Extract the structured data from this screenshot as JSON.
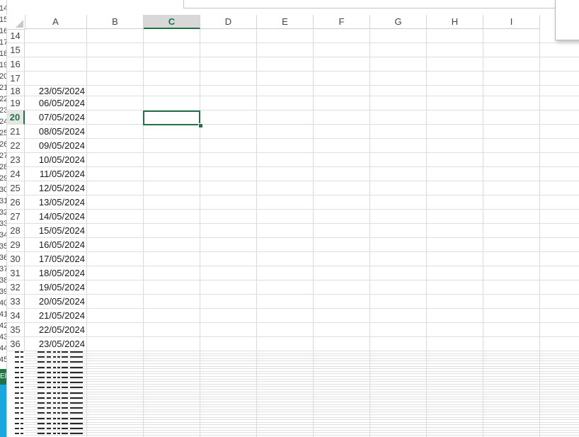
{
  "background_window": {
    "row_numbers": [
      "14",
      "15",
      "16",
      "17",
      "18",
      "19",
      "20",
      "21",
      "22",
      "23",
      "24",
      "25",
      "26",
      "27",
      "28",
      "29",
      "30",
      "31",
      "32",
      "33",
      "34",
      "35",
      "36",
      "37",
      "38",
      "39",
      "40",
      "41",
      "42",
      "43",
      "44",
      "45"
    ],
    "ribbon_text": "El",
    "colors": {
      "green_tab": "#217346",
      "blue_panel": "#1aa7e0"
    }
  },
  "sheet": {
    "columns": [
      "A",
      "B",
      "C",
      "D",
      "E",
      "F",
      "G",
      "H",
      "I"
    ],
    "selected_column": "C",
    "selected_row": "20",
    "active_cell": "C20",
    "rows": [
      {
        "num": "14",
        "a": ""
      },
      {
        "num": "15",
        "a": ""
      },
      {
        "num": "16",
        "a": ""
      },
      {
        "num": "17",
        "a": ""
      },
      {
        "num": "18",
        "a": "23/05/2024"
      },
      {
        "num": "19",
        "a": "06/05/2024"
      },
      {
        "num": "20",
        "a": "07/05/2024"
      },
      {
        "num": "21",
        "a": "08/05/2024"
      },
      {
        "num": "22",
        "a": "09/05/2024"
      },
      {
        "num": "23",
        "a": "10/05/2024"
      },
      {
        "num": "24",
        "a": "11/05/2024"
      },
      {
        "num": "25",
        "a": "12/05/2024"
      },
      {
        "num": "26",
        "a": "13/05/2024"
      },
      {
        "num": "27",
        "a": "14/05/2024"
      },
      {
        "num": "28",
        "a": "15/05/2024"
      },
      {
        "num": "29",
        "a": "16/05/2024"
      },
      {
        "num": "30",
        "a": "17/05/2024"
      },
      {
        "num": "31",
        "a": "18/05/2024"
      },
      {
        "num": "32",
        "a": "19/05/2024"
      },
      {
        "num": "33",
        "a": "20/05/2024"
      },
      {
        "num": "34",
        "a": "21/05/2024"
      },
      {
        "num": "35",
        "a": "22/05/2024"
      },
      {
        "num": "36",
        "a": "23/05/2024"
      }
    ],
    "colors": {
      "accent": "#217346",
      "gridline": "#dedede"
    }
  }
}
